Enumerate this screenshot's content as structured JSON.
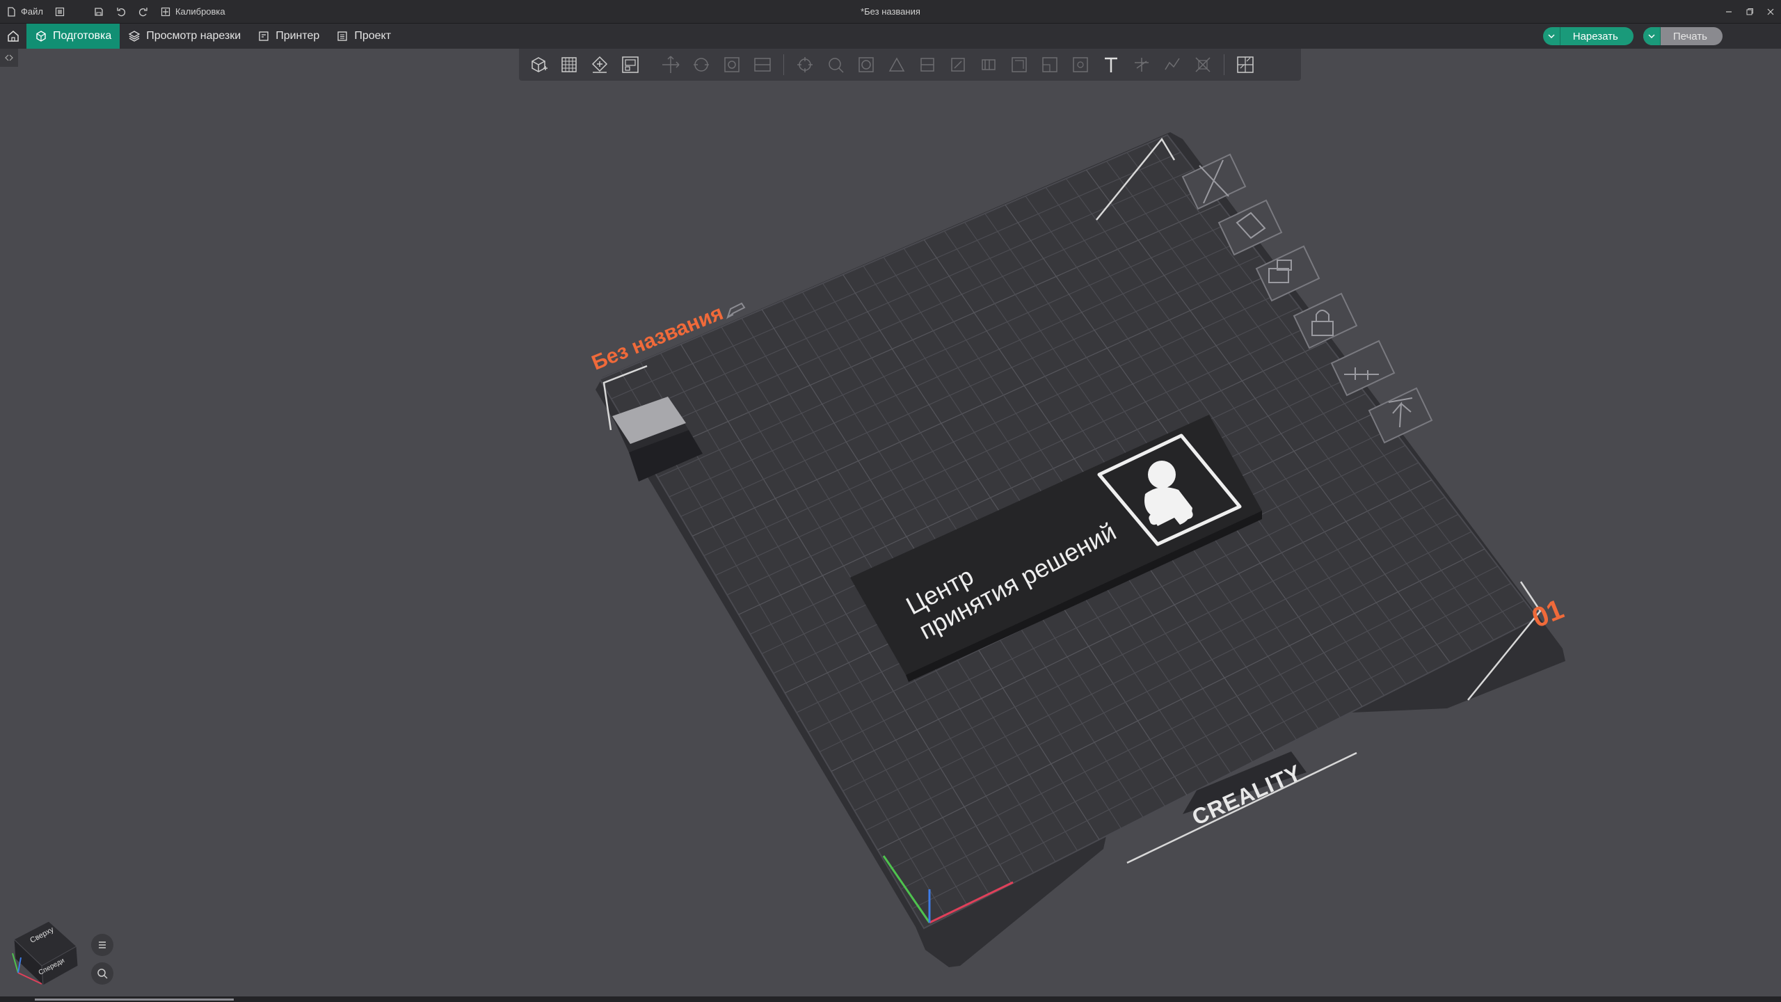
{
  "titlebar": {
    "file_label": "Файл",
    "calibration_label": "Калибровка",
    "window_title": "*Без названия"
  },
  "tabs": [
    {
      "label": "Подготовка",
      "active": true
    },
    {
      "label": "Просмотр нарезки",
      "active": false
    },
    {
      "label": "Принтер",
      "active": false
    },
    {
      "label": "Проект",
      "active": false
    }
  ],
  "actions": {
    "slice_label": "Нарезать",
    "print_label": "Печать"
  },
  "plate": {
    "name": "Без названия",
    "number": "01",
    "brand": "CREALITY"
  },
  "model": {
    "line1": "Центр",
    "line2": "принятия решений"
  },
  "view_cube": {
    "top_label": "Сверху",
    "front_label": "Спереди"
  },
  "colors": {
    "accent": "#1a9a7a",
    "plate_label": "#f06a3a",
    "background": "#4a4a4f"
  }
}
